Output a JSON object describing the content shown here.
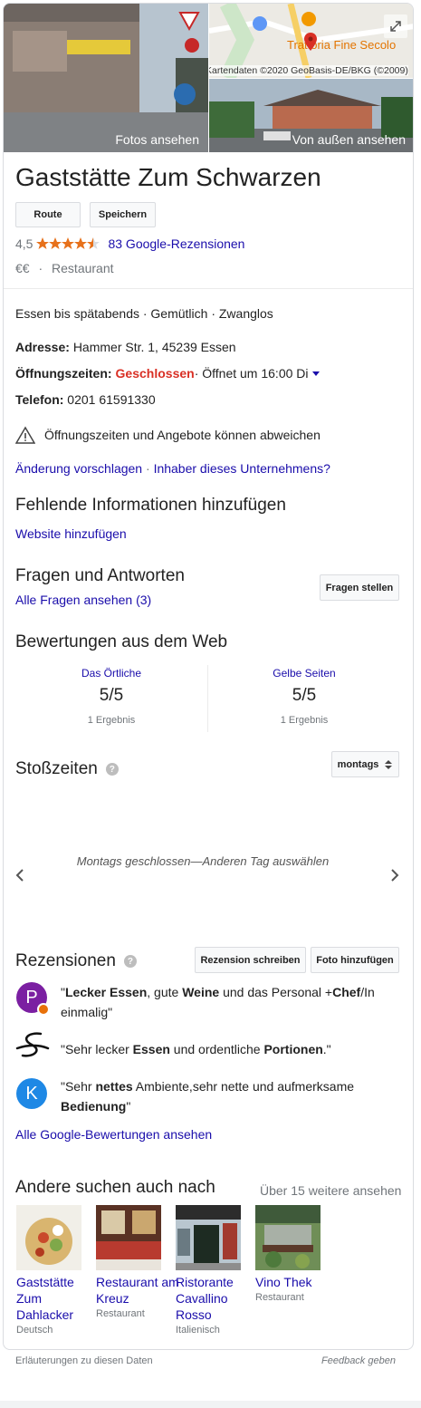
{
  "photos": {
    "left_label": "Fotos ansehen",
    "right_label": "Von außen ansehen",
    "map_credit": "Kartendaten ©2020 GeoBasis-DE/BKG (©2009)",
    "map_place": "Trattoria Fine Secolo"
  },
  "place": {
    "name": "Gaststätte Zum Schwarzen",
    "route_label": "Route",
    "save_label": "Speichern",
    "rating": "4,5",
    "stars": 4.5,
    "reviews_link": "83 Google-Rezensionen",
    "price": "€€",
    "sep": "·",
    "category": "Restaurant"
  },
  "details": {
    "tags": "Essen bis spätabends · Gemütlich · Zwanglos",
    "address_label": "Adresse:",
    "address": "Hammer Str. 1, 45239 Essen",
    "hours_label": "Öffnungszeiten:",
    "hours_status": "Geschlossen",
    "hours_next": " · Öffnet um 16:00 Di",
    "phone_label": "Telefon:",
    "phone": "0201 61591330",
    "warning": "Öffnungszeiten und Angebote können abweichen",
    "suggest_link": "Änderung vorschlagen",
    "owner_link": "Inhaber dieses Unternehmens?",
    "link_sep": " · "
  },
  "missing": {
    "title": "Fehlende Informationen hinzufügen",
    "website_link": "Website hinzufügen"
  },
  "qa": {
    "title": "Fragen und Antworten",
    "all_link": "Alle Fragen ansehen (3)",
    "ask_button": "Fragen stellen"
  },
  "web_reviews": {
    "title": "Bewertungen aus dem Web",
    "sources": [
      {
        "name": "Das Örtliche",
        "score": "5/5",
        "count": "1 Ergebnis"
      },
      {
        "name": "Gelbe Seiten",
        "score": "5/5",
        "count": "1 Ergebnis"
      }
    ]
  },
  "popular_times": {
    "title": "Stoßzeiten",
    "day_select": "montags",
    "message": "Montags geschlossen—Anderen Tag auswählen"
  },
  "reviews": {
    "title": "Rezensionen",
    "write_button": "Rezension schreiben",
    "photo_button": "Foto hinzufügen",
    "items": [
      {
        "avatar": "P",
        "color": "#7b1fa2",
        "text": [
          "\"",
          "Lecker Essen",
          ", gute ",
          "Weine",
          " und das Personal +",
          "Chef",
          "/In einmalig\""
        ]
      },
      {
        "avatar": "S",
        "color": "#111111",
        "text": [
          "\"Sehr lecker ",
          "Essen",
          " und ordentliche ",
          "Portionen",
          ".\""
        ]
      },
      {
        "avatar": "K",
        "color": "#1e88e5",
        "text": [
          "\"Sehr ",
          "nettes",
          " Ambiente,sehr nette und aufmerksame ",
          "Bedienung",
          "\""
        ]
      }
    ],
    "all_link": "Alle Google-Bewertungen ansehen"
  },
  "also_search": {
    "title": "Andere suchen auch nach",
    "more_link": "Über 15 weitere ansehen",
    "items": [
      {
        "name": "Gaststätte Zum Dahlacker",
        "type": "Deutsch"
      },
      {
        "name": "Restaurant am Kreuz",
        "type": "Restaurant"
      },
      {
        "name": "Ristorante Cavallino Rosso",
        "type": "Italienisch"
      },
      {
        "name": "Vino Thek",
        "type": "Restaurant"
      }
    ]
  },
  "footer": {
    "explain": "Erläuterungen zu diesen Daten",
    "feedback": "Feedback geben"
  },
  "colors": {
    "link": "#1a0dab",
    "closed": "#d93025",
    "star": "#e7711b"
  },
  "icons": [
    "expand-icon",
    "star-icon",
    "warning-icon",
    "help-icon",
    "chevron-left-icon",
    "chevron-right-icon",
    "dropdown-arrow-icon",
    "map-pin-icon"
  ]
}
